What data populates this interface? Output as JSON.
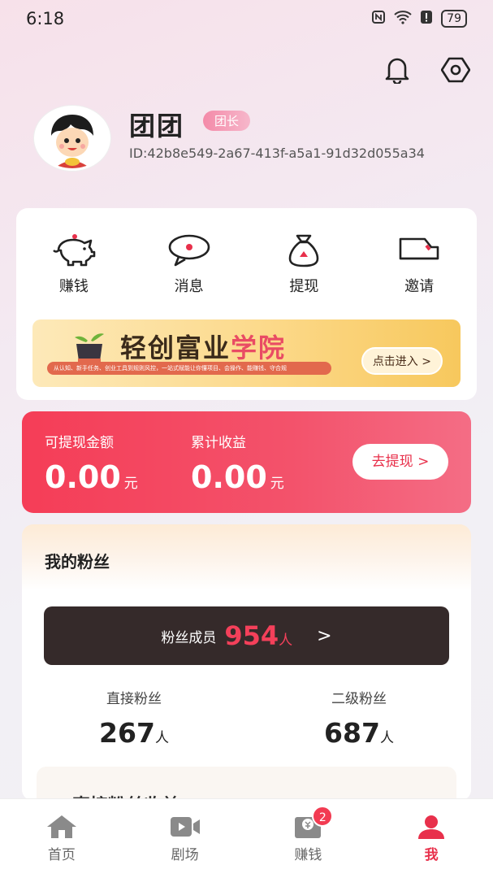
{
  "status_bar": {
    "time": "6:18",
    "battery": "79"
  },
  "profile": {
    "name": "团团",
    "badge": "团长",
    "uid": "ID:42b8e549-2a67-413f-a5a1-91d32d055a34"
  },
  "menu": {
    "items": [
      {
        "label": "赚钱",
        "icon": "piggy-bank-icon"
      },
      {
        "label": "消息",
        "icon": "message-icon"
      },
      {
        "label": "提现",
        "icon": "money-bag-icon"
      },
      {
        "label": "邀请",
        "icon": "truck-icon"
      }
    ]
  },
  "banner": {
    "title_main": "轻创富业",
    "title_accent": "学院",
    "subtitle": "从认知、新手任务、创业工具到规则风控，一站式赋能让你懂项目、会操作、能赚钱、守合规",
    "button": "点击进入 >"
  },
  "earnings": {
    "withdrawable_label": "可提现金额",
    "withdrawable_value": "0.00",
    "cumulative_label": "累计收益",
    "cumulative_value": "0.00",
    "unit": "元",
    "withdraw_button": "去提现 >"
  },
  "fans": {
    "title": "我的粉丝",
    "members_label": "粉丝成员",
    "members_count": "954",
    "members_unit": "人",
    "members_arrow": ">",
    "direct_label": "直接粉丝",
    "direct_value": "267",
    "second_label": "二级粉丝",
    "second_value": "687",
    "unit": "人",
    "peek_text": "直接粉丝收益"
  },
  "tabbar": {
    "tabs": [
      {
        "label": "首页",
        "icon": "home-icon"
      },
      {
        "label": "剧场",
        "icon": "video-icon"
      },
      {
        "label": "赚钱",
        "icon": "envelope-yuan-icon",
        "badge": "2"
      },
      {
        "label": "我",
        "icon": "person-icon"
      }
    ]
  },
  "colors": {
    "accent": "#e8304b",
    "earn_gradient_start": "#f53d57",
    "members_bar": "#352a2a"
  }
}
